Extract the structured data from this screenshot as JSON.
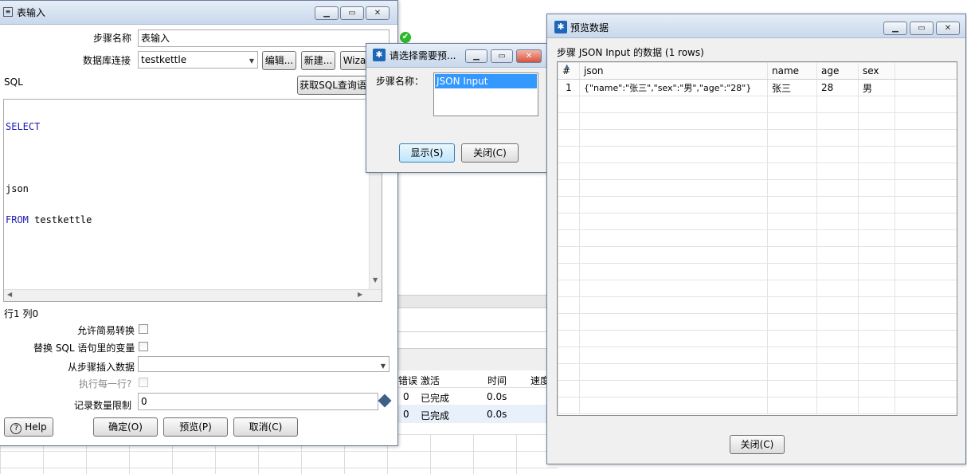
{
  "background": {
    "status_cols": [
      "错误",
      "激活",
      "时间",
      "速度"
    ],
    "status_rows": [
      {
        "err": "0",
        "state": "已完成",
        "time": "0.0s"
      },
      {
        "err": "0",
        "state": "已完成",
        "time": "0.0s"
      }
    ]
  },
  "table_input": {
    "title": "表输入",
    "step_name_label": "步骤名称",
    "step_name_value": "表输入",
    "db_label": "数据库连接",
    "db_value": "testkettle",
    "edit_btn": "编辑...",
    "new_btn": "新建...",
    "wizard_btn": "Wiza",
    "sql_label": "SQL",
    "get_sql_btn": "获取SQL查询语",
    "sql_lines": [
      "SELECT",
      "",
      "json",
      "FROM testkettle"
    ],
    "cursor_pos": "行1 列0",
    "lazy_conv_label": "允许简易转换",
    "replace_var_label": "替换 SQL 语句里的变量",
    "insert_from_label": "从步骤插入数据",
    "exec_each_label": "执行每一行?",
    "limit_label": "记录数量限制",
    "limit_value": "0",
    "help_btn": "Help",
    "ok_btn": "确定(O)",
    "preview_btn": "预览(P)",
    "cancel_btn": "取消(C)"
  },
  "select_dialog": {
    "title": "请选择需要预...",
    "step_label": "步骤名称：",
    "items": [
      "JSON Input"
    ],
    "show_btn": "显示(S)",
    "close_btn": "关闭(C)"
  },
  "preview": {
    "title": "预览数据",
    "heading": "步骤 JSON Input 的数据  (1 rows)",
    "columns": [
      "#",
      "json",
      "name",
      "age",
      "sex"
    ],
    "rows": [
      {
        "num": "1",
        "json": "{\"name\":\"张三\",\"sex\":\"男\",\"age\":\"28\"}",
        "name": "张三",
        "age": "28",
        "sex": "男"
      }
    ],
    "close_btn": "关闭(C)"
  },
  "colors": {
    "accent": "#1e66b8",
    "selection": "#3399ff",
    "check": "#2eb82e"
  }
}
